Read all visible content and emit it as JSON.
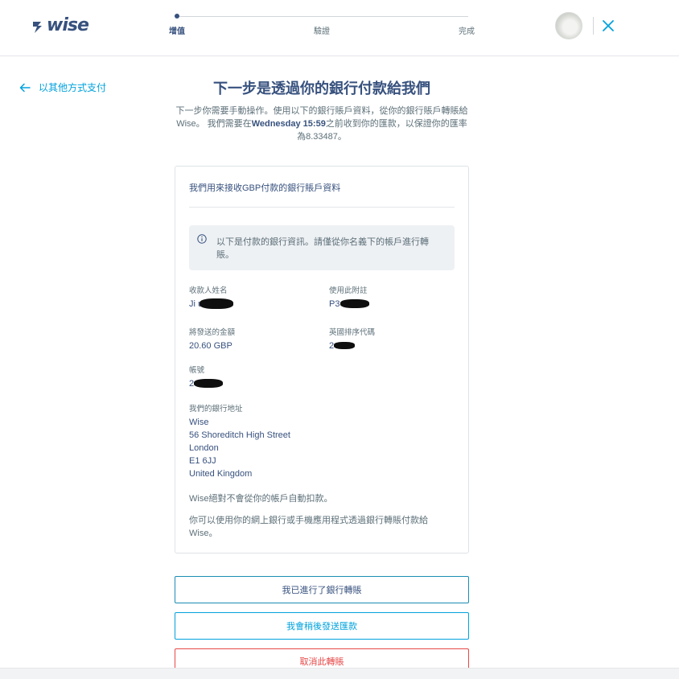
{
  "header": {
    "logo_text": "wise",
    "steps": [
      {
        "label": "增值",
        "active": true
      },
      {
        "label": "驗證",
        "active": false
      },
      {
        "label": "完成",
        "active": false
      }
    ]
  },
  "back_link": {
    "label": "以其他方式支付"
  },
  "title": "下一步是透過你的銀行付款給我們",
  "intro": {
    "part1": "下一步你需要手動操作。使用以下的銀行賬戶資料，從你的銀行賬戶轉賬給Wise。 我們需要在",
    "deadline": "Wednesday 15:59",
    "part2": "之前收到你的匯款，以保證你的匯率為8.33487。"
  },
  "card": {
    "title": "我們用來接收GBP付款的銀行賬戶資料",
    "info": "以下是付款的銀行資訊。請僅從你名義下的帳戶進行轉賬。",
    "fields": {
      "recipient_name": {
        "label": "收款人姓名",
        "value": "Ji       u"
      },
      "reference": {
        "label": "使用此附註",
        "value": "P3          0"
      },
      "amount": {
        "label": "將發送的金額",
        "value": "20.60 GBP"
      },
      "sort_code": {
        "label": "英國排序代碼",
        "value": "2      0"
      },
      "account_number": {
        "label": "帳號",
        "value": "2        1"
      }
    },
    "address": {
      "label": "我們的銀行地址",
      "lines": [
        "Wise",
        "56 Shoreditch High Street",
        "London",
        "E1 6JJ",
        "United Kingdom"
      ]
    },
    "note1": "Wise絕對不會從你的帳戶自動扣款。",
    "note2": "你可以使用你的網上銀行或手機應用程式透過銀行轉賬付款給Wise。"
  },
  "buttons": {
    "done": "我已進行了銀行轉賬",
    "later": "我會稍後發送匯款",
    "cancel": "取消此轉賬"
  },
  "colors": {
    "brand_navy": "#37517e",
    "accent_blue": "#00a2dd",
    "danger_red": "#e74848"
  }
}
